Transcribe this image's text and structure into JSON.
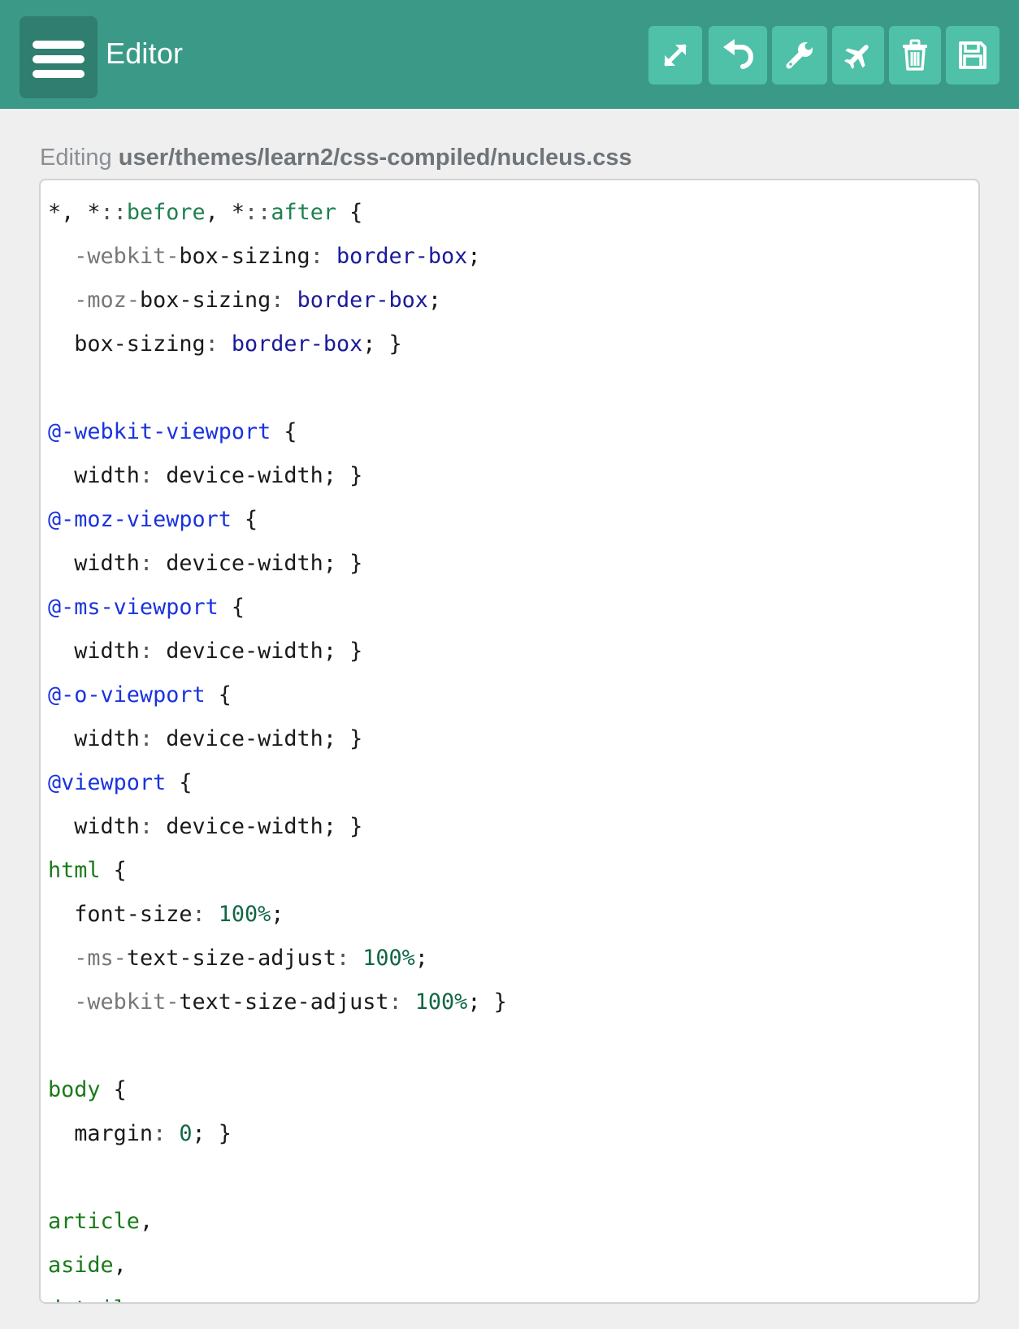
{
  "header": {
    "title": "Editor",
    "menu_icon": "hamburger-menu-icon",
    "toolbar": [
      {
        "name": "fullscreen-button",
        "icon": "expand-arrows-icon"
      },
      {
        "name": "undo-button",
        "icon": "undo-arrow-icon"
      },
      {
        "name": "settings-button",
        "icon": "wrench-icon"
      },
      {
        "name": "deploy-button",
        "icon": "airplane-icon"
      },
      {
        "name": "delete-button",
        "icon": "trash-icon"
      },
      {
        "name": "save-button",
        "icon": "floppy-disk-icon"
      }
    ]
  },
  "file": {
    "editing_label": "Editing",
    "path": "user/themes/learn2/css-compiled/nucleus.css"
  },
  "colors": {
    "header_bg": "#3a9a87",
    "button_bg": "#4fc1a8",
    "menu_bg": "#2f7e6f",
    "page_bg": "#efefef"
  },
  "code_lines": [
    [
      [
        "plain",
        "*, *"
      ],
      [
        "punct",
        "::"
      ],
      [
        "attr",
        "before"
      ],
      [
        "plain",
        ", *"
      ],
      [
        "punct",
        "::"
      ],
      [
        "attr",
        "after"
      ],
      [
        "plain",
        " {"
      ]
    ],
    [
      [
        "plain",
        "  "
      ],
      [
        "vendor",
        "-webkit-"
      ],
      [
        "plain",
        "box-sizing"
      ],
      [
        "punct",
        ": "
      ],
      [
        "val",
        "border-box"
      ],
      [
        "plain",
        ";"
      ]
    ],
    [
      [
        "plain",
        "  "
      ],
      [
        "vendor",
        "-moz-"
      ],
      [
        "plain",
        "box-sizing"
      ],
      [
        "punct",
        ": "
      ],
      [
        "val",
        "border-box"
      ],
      [
        "plain",
        ";"
      ]
    ],
    [
      [
        "plain",
        "  box-sizing"
      ],
      [
        "punct",
        ": "
      ],
      [
        "val",
        "border-box"
      ],
      [
        "plain",
        "; }"
      ]
    ],
    [],
    [
      [
        "at",
        "@-webkit-viewport"
      ],
      [
        "plain",
        " {"
      ]
    ],
    [
      [
        "plain",
        "  width"
      ],
      [
        "punct",
        ": "
      ],
      [
        "plain",
        "device-width; }"
      ]
    ],
    [
      [
        "at",
        "@-moz-viewport"
      ],
      [
        "plain",
        " {"
      ]
    ],
    [
      [
        "plain",
        "  width"
      ],
      [
        "punct",
        ": "
      ],
      [
        "plain",
        "device-width; }"
      ]
    ],
    [
      [
        "at",
        "@-ms-viewport"
      ],
      [
        "plain",
        " {"
      ]
    ],
    [
      [
        "plain",
        "  width"
      ],
      [
        "punct",
        ": "
      ],
      [
        "plain",
        "device-width; }"
      ]
    ],
    [
      [
        "at",
        "@-o-viewport"
      ],
      [
        "plain",
        " {"
      ]
    ],
    [
      [
        "plain",
        "  width"
      ],
      [
        "punct",
        ": "
      ],
      [
        "plain",
        "device-width; }"
      ]
    ],
    [
      [
        "at",
        "@viewport"
      ],
      [
        "plain",
        " {"
      ]
    ],
    [
      [
        "plain",
        "  width"
      ],
      [
        "punct",
        ": "
      ],
      [
        "plain",
        "device-width; }"
      ]
    ],
    [
      [
        "tag",
        "html"
      ],
      [
        "plain",
        " {"
      ]
    ],
    [
      [
        "plain",
        "  font-size"
      ],
      [
        "punct",
        ": "
      ],
      [
        "num",
        "100%"
      ],
      [
        "plain",
        ";"
      ]
    ],
    [
      [
        "plain",
        "  "
      ],
      [
        "vendor",
        "-ms-"
      ],
      [
        "plain",
        "text-size-adjust"
      ],
      [
        "punct",
        ": "
      ],
      [
        "num",
        "100%"
      ],
      [
        "plain",
        ";"
      ]
    ],
    [
      [
        "plain",
        "  "
      ],
      [
        "vendor",
        "-webkit-"
      ],
      [
        "plain",
        "text-size-adjust"
      ],
      [
        "punct",
        ": "
      ],
      [
        "num",
        "100%"
      ],
      [
        "plain",
        "; }"
      ]
    ],
    [],
    [
      [
        "tag",
        "body"
      ],
      [
        "plain",
        " {"
      ]
    ],
    [
      [
        "plain",
        "  margin"
      ],
      [
        "punct",
        ": "
      ],
      [
        "num",
        "0"
      ],
      [
        "plain",
        "; }"
      ]
    ],
    [],
    [
      [
        "tag",
        "article"
      ],
      [
        "plain",
        ","
      ]
    ],
    [
      [
        "tag",
        "aside"
      ],
      [
        "plain",
        ","
      ]
    ],
    [
      [
        "tag",
        "details"
      ],
      [
        "plain",
        ","
      ]
    ]
  ]
}
